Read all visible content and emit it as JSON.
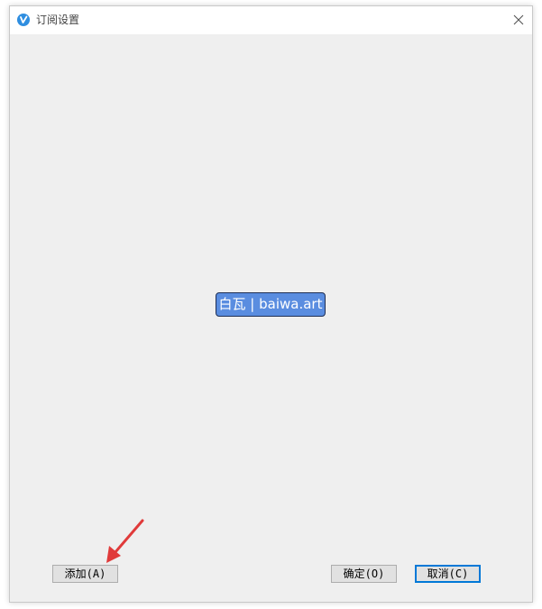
{
  "window": {
    "title": "订阅设置",
    "icon": "app-logo-icon",
    "close_icon": "close-icon"
  },
  "content": {
    "watermark_text": "白瓦 | baiwa.art"
  },
  "buttons": {
    "add_label": "添加(A)",
    "ok_label": "确定(O)",
    "cancel_label": "取消(C)"
  },
  "annotation": {
    "arrow_icon": "arrow-icon",
    "arrow_color": "#e03a3a"
  },
  "colors": {
    "accent": "#0078d7",
    "app_icon": "#2f8ee0",
    "watermark_bg": "#5a8de0"
  }
}
